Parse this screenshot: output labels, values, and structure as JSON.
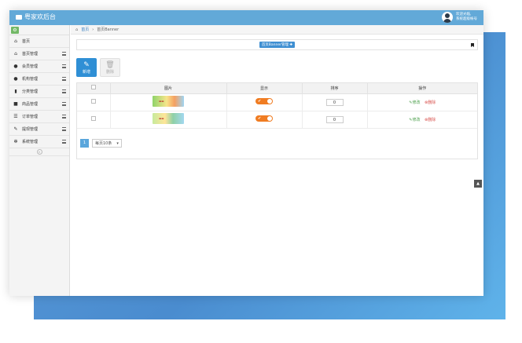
{
  "app": {
    "title": "粤家欢后台"
  },
  "user": {
    "line1": "欢迎光临,",
    "line2": "系统超级帐号"
  },
  "sidebar": {
    "items": [
      {
        "label": "首页",
        "icon": "home-icon"
      },
      {
        "label": "首页管理",
        "icon": "home-icon"
      },
      {
        "label": "会员管理",
        "icon": "user-icon"
      },
      {
        "label": "机构管理",
        "icon": "user-icon"
      },
      {
        "label": "分类管理",
        "icon": "bookmark-icon"
      },
      {
        "label": "商品管理",
        "icon": "gift-icon"
      },
      {
        "label": "订单管理",
        "icon": "list-icon"
      },
      {
        "label": "提现管理",
        "icon": "edit-icon"
      },
      {
        "label": "系统管理",
        "icon": "gears-icon"
      }
    ]
  },
  "breadcrumb": {
    "home": "首页",
    "current": "首页Banner"
  },
  "header": {
    "button": "首页Banner管理 ✚"
  },
  "toolbar": {
    "add": "新增",
    "delete": "删除"
  },
  "table": {
    "headers": [
      "",
      "图片",
      "显示",
      "排序",
      "操作"
    ],
    "rows": [
      {
        "sort": "0",
        "edit": "修改",
        "delete": "删除"
      },
      {
        "sort": "0",
        "edit": "修改",
        "delete": "删除"
      }
    ]
  },
  "pager": {
    "page": "1",
    "size": "每页10条"
  }
}
